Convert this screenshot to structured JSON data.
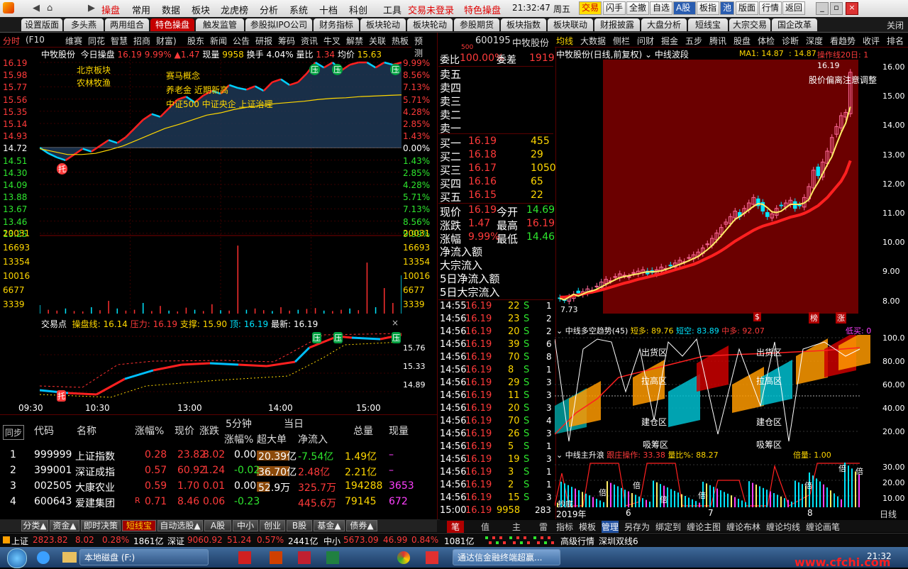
{
  "menubar": {
    "items": [
      "操盘",
      "常用",
      "数据",
      "板块",
      "龙虎榜",
      "分析",
      "系统",
      "十档",
      "科创",
      "工具"
    ],
    "hot_items": [
      "交易未登录",
      "特色操盘"
    ],
    "clock": "21:32:47",
    "weekday": "周五",
    "tools": [
      "交易",
      "闪手",
      "全撤",
      "自选",
      "A股",
      "板指",
      "池",
      "版面",
      "行情",
      "返回"
    ]
  },
  "tabs": [
    "设置版面",
    "多头燕",
    "两用组合",
    "特色操盘",
    "触发监管",
    "参股拟IPO公司",
    "财务指标",
    "板块轮动",
    "板块轮动",
    "参股期货",
    "板块指数",
    "板块联动",
    "财报披露",
    "大盘分析",
    "短线宝",
    "大宗交易",
    "国企改革"
  ],
  "close_label": "关闭",
  "subtabs": [
    "分时",
    "(F10",
    "维赛",
    "同花",
    "智慧",
    "招商",
    "财富)",
    "股东",
    "新闻",
    "公告",
    "研报",
    "筹码",
    "资讯",
    "牛叉",
    "解禁",
    "关联",
    "热板",
    "预测"
  ],
  "intraday": {
    "header": {
      "name": "中牧股份",
      "mode": "今日操盘",
      "price": "16.19",
      "pct": "9.99%",
      "change": "▲1.47",
      "vol_label": "现量",
      "vol": "9958",
      "turnover_label": "换手",
      "turnover": "4.04%",
      "ratio_label": "量比",
      "ratio": "1.34",
      "avg_label": "均价",
      "avg": "15.63"
    },
    "left_axis": [
      "16.19",
      "15.98",
      "15.77",
      "15.56",
      "15.35",
      "15.14",
      "14.93",
      "14.72",
      "14.51",
      "14.30",
      "14.09",
      "13.88",
      "13.67",
      "13.46",
      "13.25"
    ],
    "right_axis": [
      "9.99%",
      "8.56%",
      "7.13%",
      "5.71%",
      "4.28%",
      "2.85%",
      "1.43%",
      "0.00%",
      "1.43%",
      "2.85%",
      "4.28%",
      "5.71%",
      "7.13%",
      "8.56%",
      "9.99%"
    ],
    "vol_axis": [
      "20031",
      "16693",
      "13354",
      "10016",
      "6677",
      "3339"
    ],
    "annotations": [
      "北京板块",
      "农林牧渔",
      "赛马概念",
      "养老金 近期新高",
      "中证500 中证央企 上证治理"
    ],
    "prices": [
      14.72,
      14.62,
      14.55,
      14.5,
      14.6,
      14.7,
      14.65,
      14.75,
      14.85,
      14.8,
      14.9,
      15.05,
      15.2,
      15.3,
      15.25,
      15.4,
      15.55,
      15.6,
      15.5,
      15.62,
      15.7,
      15.65,
      15.8,
      15.75,
      15.72,
      15.78,
      15.7,
      15.85,
      15.9,
      15.8,
      15.85,
      16.0,
      16.19,
      16.1,
      16.19,
      16.05,
      16.15,
      16.19,
      16.19,
      16.1,
      16.19,
      16.15,
      16.19
    ],
    "avg_line": [
      14.7,
      14.65,
      14.6,
      14.6,
      14.62,
      14.68,
      14.75,
      14.85,
      14.95,
      15.05,
      15.12,
      15.2,
      15.28,
      15.32,
      15.38,
      15.42,
      15.45,
      15.48,
      15.5,
      15.52,
      15.55,
      15.57,
      15.58,
      15.6,
      15.61,
      15.62,
      15.63
    ],
    "volumes": [
      2000,
      900,
      700,
      1200,
      600,
      500,
      1500,
      800,
      3000,
      1200,
      700,
      900,
      2500,
      600,
      1800,
      700,
      500,
      1400,
      900,
      600,
      2200,
      800,
      700,
      16000,
      900,
      1200,
      800,
      600,
      1500,
      700,
      900,
      1100,
      1300,
      700,
      600,
      900,
      1200,
      800,
      12000,
      1500,
      6000,
      2500,
      9000
    ]
  },
  "trade_panel": {
    "header": {
      "label": "交易点",
      "line": "操盘线",
      "line_v": "16.14",
      "press": "压力",
      "press_v": "16.19",
      "support": "支撑",
      "support_v": "15.90",
      "top": "顶",
      "top_v": "16.19",
      "latest": "最新",
      "latest_v": "16.19"
    },
    "axis": [
      "15.76",
      "15.33",
      "14.89"
    ],
    "times": [
      "09:30",
      "10:30",
      "13:00",
      "14:00",
      "15:00"
    ],
    "marks": [
      "托",
      "压",
      "压",
      "压"
    ]
  },
  "orderbook": {
    "code": "600195",
    "name": "中牧股份",
    "weibi_label": "委比",
    "weibi": "100.00%",
    "weicha_label": "委差",
    "weicha": "1919",
    "ask_marker": "500",
    "asks": [
      "卖五",
      "卖四",
      "卖三",
      "卖二",
      "卖一"
    ],
    "bids": [
      {
        "label": "买一",
        "price": "16.19",
        "vol": "455"
      },
      {
        "label": "买二",
        "price": "16.18",
        "vol": "29"
      },
      {
        "label": "买三",
        "price": "16.17",
        "vol": "1050"
      },
      {
        "label": "买四",
        "price": "16.16",
        "vol": "65"
      },
      {
        "label": "买五",
        "price": "16.15",
        "vol": "22"
      }
    ],
    "quote": [
      {
        "l1": "现价",
        "v1": "16.19",
        "l2": "今开",
        "v2": "14.69"
      },
      {
        "l1": "涨跌",
        "v1": "1.47",
        "l2": "最高",
        "v2": "16.19"
      },
      {
        "l1": "涨幅",
        "v1": "9.99%",
        "l2": "最低",
        "v2": "14.46"
      }
    ],
    "flows": [
      "净流入额",
      "大宗流入",
      "5日净流入额",
      "5日大宗流入"
    ]
  },
  "ticks": [
    {
      "t": "14:55",
      "p": "16.19",
      "v": "22",
      "s": "S",
      "n": "1"
    },
    {
      "t": "14:56",
      "p": "16.19",
      "v": "23",
      "s": "S",
      "n": "2"
    },
    {
      "t": "14:56",
      "p": "16.19",
      "v": "20",
      "s": "S",
      "n": "2"
    },
    {
      "t": "14:56",
      "p": "16.19",
      "v": "39",
      "s": "S",
      "n": "6"
    },
    {
      "t": "14:56",
      "p": "16.19",
      "v": "70",
      "s": "S",
      "n": "8"
    },
    {
      "t": "14:56",
      "p": "16.19",
      "v": "8",
      "s": "S",
      "n": "1"
    },
    {
      "t": "14:56",
      "p": "16.19",
      "v": "29",
      "s": "S",
      "n": "3"
    },
    {
      "t": "14:56",
      "p": "16.19",
      "v": "11",
      "s": "S",
      "n": "3"
    },
    {
      "t": "14:56",
      "p": "16.19",
      "v": "20",
      "s": "S",
      "n": "3"
    },
    {
      "t": "14:56",
      "p": "16.19",
      "v": "70",
      "s": "S",
      "n": "4"
    },
    {
      "t": "14:56",
      "p": "16.19",
      "v": "26",
      "s": "S",
      "n": "3"
    },
    {
      "t": "14:56",
      "p": "16.19",
      "v": "5",
      "s": "S",
      "n": "1"
    },
    {
      "t": "14:56",
      "p": "16.19",
      "v": "19",
      "s": "S",
      "n": "3"
    },
    {
      "t": "14:56",
      "p": "16.19",
      "v": "3",
      "s": "S",
      "n": "1"
    },
    {
      "t": "14:56",
      "p": "16.19",
      "v": "2",
      "s": "S",
      "n": "1"
    },
    {
      "t": "14:56",
      "p": "16.19",
      "v": "15",
      "s": "S",
      "n": "3"
    },
    {
      "t": "15:00",
      "p": "16.19",
      "v": "9958",
      "s": "",
      "n": "283"
    }
  ],
  "tick_footer": [
    "笔",
    "值",
    "主",
    "雷"
  ],
  "index_table": {
    "sync_label": "同步",
    "headers": [
      "代码",
      "名称",
      "涨幅%",
      "现价",
      "涨跌",
      "5分钟",
      "涨幅%",
      "当日",
      "超大单",
      "净流入",
      "总量",
      "现量"
    ],
    "rows": [
      {
        "n": "1",
        "code": "999999",
        "name": "上证指数",
        "pct": "0.28",
        "price": "23.82",
        "chg": "8.02",
        "m5": "0.00",
        "big": "20.39亿",
        "net": "-7.54亿",
        "total": "1.49亿",
        "cur": "–"
      },
      {
        "n": "2",
        "code": "399001",
        "name": "深证成指",
        "pct": "0.57",
        "price": "60.92",
        "chg": "1.24",
        "m5": "-0.02",
        "big": "36.70亿",
        "net": "2.48亿",
        "total": "2.21亿",
        "cur": "–"
      },
      {
        "n": "3",
        "code": "002505",
        "name": "大康农业",
        "pct": "0.59",
        "price": "1.70",
        "chg": "0.01",
        "m5": "0.00",
        "big": "52.9万",
        "net": "325.7万",
        "total": "194288",
        "cur": "3653"
      },
      {
        "n": "4",
        "code": "600643",
        "name": "爱建集团",
        "pct": "0.71",
        "price": "8.46",
        "chg": "0.06",
        "m5": "-0.23",
        "big": "",
        "net": "445.6万",
        "total": "79145",
        "cur": "672"
      }
    ],
    "flag_r": "R"
  },
  "bottom_tabs": [
    "分类▲",
    "资金▲",
    "即时决策",
    "短线宝",
    "自动选股▲",
    "A股",
    "中小",
    "创业",
    "B股",
    "基金▲",
    "债券▲"
  ],
  "kline": {
    "toptabs": [
      "均线",
      "大数据",
      "侧栏",
      "问财",
      "掘金",
      "五步",
      "腾讯",
      "股盘",
      "体检",
      "诊断",
      "深度",
      "看趋势",
      "收评",
      "排名"
    ],
    "title": "中牧股份(日线,前复权)",
    "indicator": "中线波段",
    "ma_label": "MA1: 14.87",
    "ma2": ": 14.87",
    "op_line": "操作线20日: 1",
    "high_label": "16.19",
    "warn": "股价偏离注意调整",
    "low_label": "7.73",
    "axis": [
      "16.00",
      "15.00",
      "14.00",
      "13.00",
      "12.00",
      "11.00",
      "10.00",
      "9.00",
      "8.00"
    ],
    "closes": [
      7.9,
      7.85,
      7.95,
      8.05,
      8.1,
      8.15,
      8.25,
      8.2,
      8.35,
      8.5,
      8.6,
      8.55,
      8.7,
      8.8,
      8.75,
      8.7,
      8.85,
      8.9,
      8.95,
      8.8,
      8.85,
      8.95,
      9.05,
      9.0,
      9.1,
      9.2,
      9.3,
      9.25,
      9.4,
      9.5,
      9.6,
      9.75,
      9.9,
      10.1,
      10.3,
      10.5,
      10.7,
      10.9,
      11.1,
      10.9,
      11.2,
      11.4,
      11.6,
      11.3,
      11.1,
      10.9,
      11.0,
      11.2,
      11.3,
      11.4,
      11.5,
      11.2,
      11.3,
      11.6,
      12.0,
      12.6,
      12.4,
      12.9,
      13.3,
      13.8,
      14.2,
      14.6,
      14.72,
      16.19
    ],
    "ma20": [
      7.95,
      7.95,
      7.97,
      8.0,
      8.03,
      8.06,
      8.1,
      8.13,
      8.17,
      8.21,
      8.26,
      8.31,
      8.36,
      8.41,
      8.46,
      8.5,
      8.55,
      8.6,
      8.64,
      8.68,
      8.72,
      8.76,
      8.8,
      8.85,
      8.9,
      8.95,
      9.0,
      9.05,
      9.1,
      9.15,
      9.22,
      9.3,
      9.38,
      9.46,
      9.55,
      9.65,
      9.76,
      9.88,
      10.0,
      10.1,
      10.2,
      10.3,
      10.4,
      10.48,
      10.55,
      10.6,
      10.65,
      10.7,
      10.76,
      10.82,
      10.88,
      10.92,
      10.96,
      11.02,
      11.1,
      11.2,
      11.3,
      11.45,
      11.6,
      11.8,
      12.0,
      12.2,
      12.5,
      12.95
    ],
    "bottom_labels": [
      "$",
      "榜",
      "涨"
    ],
    "mid": {
      "title": "中线多空趋势(45)",
      "short_long": "短多: 89.76",
      "short_empty": "短空: 83.89",
      "mid_long": "中多: 92.07",
      "low_buy": "低买: 0",
      "axis": [
        "100.0",
        "80.00",
        "60.00",
        "40.00",
        "20.00"
      ],
      "labels": [
        "出货区",
        "出货区",
        "拉高区",
        "拉高区",
        "建仓区",
        "建仓区",
        "吸筹区",
        "吸筹区"
      ]
    },
    "bot": {
      "title": "中线主升浪",
      "follow": "跟庄操作: 33.38",
      "ratio": "量比%: 88.27",
      "times": "倍量: 1.00",
      "axis": [
        "30.00",
        "20.00",
        "10.00"
      ],
      "marks": [
        "倍",
        "倍",
        "倍",
        "倍",
        "倍",
        "倍",
        "倍"
      ],
      "buy_mark": "抄底"
    },
    "x_labels": [
      "2019年",
      "6",
      "7",
      "8"
    ],
    "period": "日线",
    "footer": [
      "指标",
      "模板",
      "管理",
      "另存为",
      "绑定到",
      "缠论主图",
      "缠论布林",
      "缠论均线",
      "缠论画笔"
    ]
  },
  "statusbar": {
    "sh": {
      "name": "上证",
      "val": "2823.82",
      "chg": "8.02",
      "pct": "0.28%",
      "amt": "1861亿"
    },
    "sz": {
      "name": "深证",
      "val": "9060.92",
      "chg": "51.24",
      "pct": "0.57%",
      "amt": "2441亿"
    },
    "zx": {
      "name": "中小",
      "val": "5673.09",
      "chg": "46.99",
      "pct": "0.84%",
      "amt": "1081亿"
    },
    "right": "高级行情",
    "right2": "深圳双线6"
  },
  "taskbar": {
    "items": [
      "本地磁盘 (F:)",
      "通达信金融终端超赢..."
    ],
    "time": "21:32",
    "watermark": "www.cfchi.com"
  }
}
